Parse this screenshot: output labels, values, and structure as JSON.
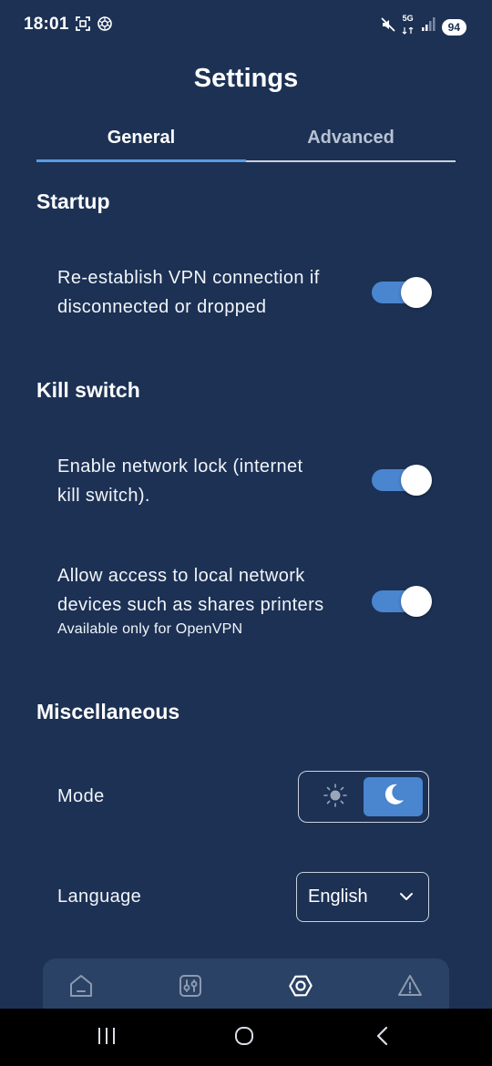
{
  "status_bar": {
    "time": "18:01",
    "network": "5G",
    "battery": "94",
    "icons": [
      "screenshot-icon",
      "chatgpt-icon",
      "mute-icon",
      "network-icon",
      "signal-icon",
      "battery-icon"
    ]
  },
  "page": {
    "title": "Settings"
  },
  "tabs": [
    {
      "label": "General",
      "active": true
    },
    {
      "label": "Advanced",
      "active": false
    }
  ],
  "sections": {
    "startup": {
      "heading": "Startup",
      "reconnect": {
        "line1": "Re-establish VPN connection if",
        "line2": "disconnected or dropped",
        "enabled": true
      }
    },
    "kill_switch": {
      "heading": "Kill switch",
      "network_lock": {
        "line1": "Enable network lock (internet",
        "line2": "kill switch).",
        "enabled": true
      },
      "local_access": {
        "line1": "Allow access to local network",
        "line2": "devices such as shares printers",
        "note": "Available only for OpenVPN",
        "enabled": true
      }
    },
    "misc": {
      "heading": "Miscellaneous",
      "mode": {
        "label": "Mode",
        "selected": "dark"
      },
      "language": {
        "label": "Language",
        "value": "English"
      }
    }
  },
  "bottom_nav": {
    "items": [
      {
        "icon": "home-icon",
        "active": false
      },
      {
        "icon": "sliders-icon",
        "active": false
      },
      {
        "icon": "settings-icon",
        "active": true
      },
      {
        "icon": "alert-icon",
        "active": false
      }
    ]
  },
  "colors": {
    "background": "#1c3154",
    "accent": "#4a85cf",
    "tab_indicator": "#5b9be0",
    "nav_background": "#2a4265"
  }
}
